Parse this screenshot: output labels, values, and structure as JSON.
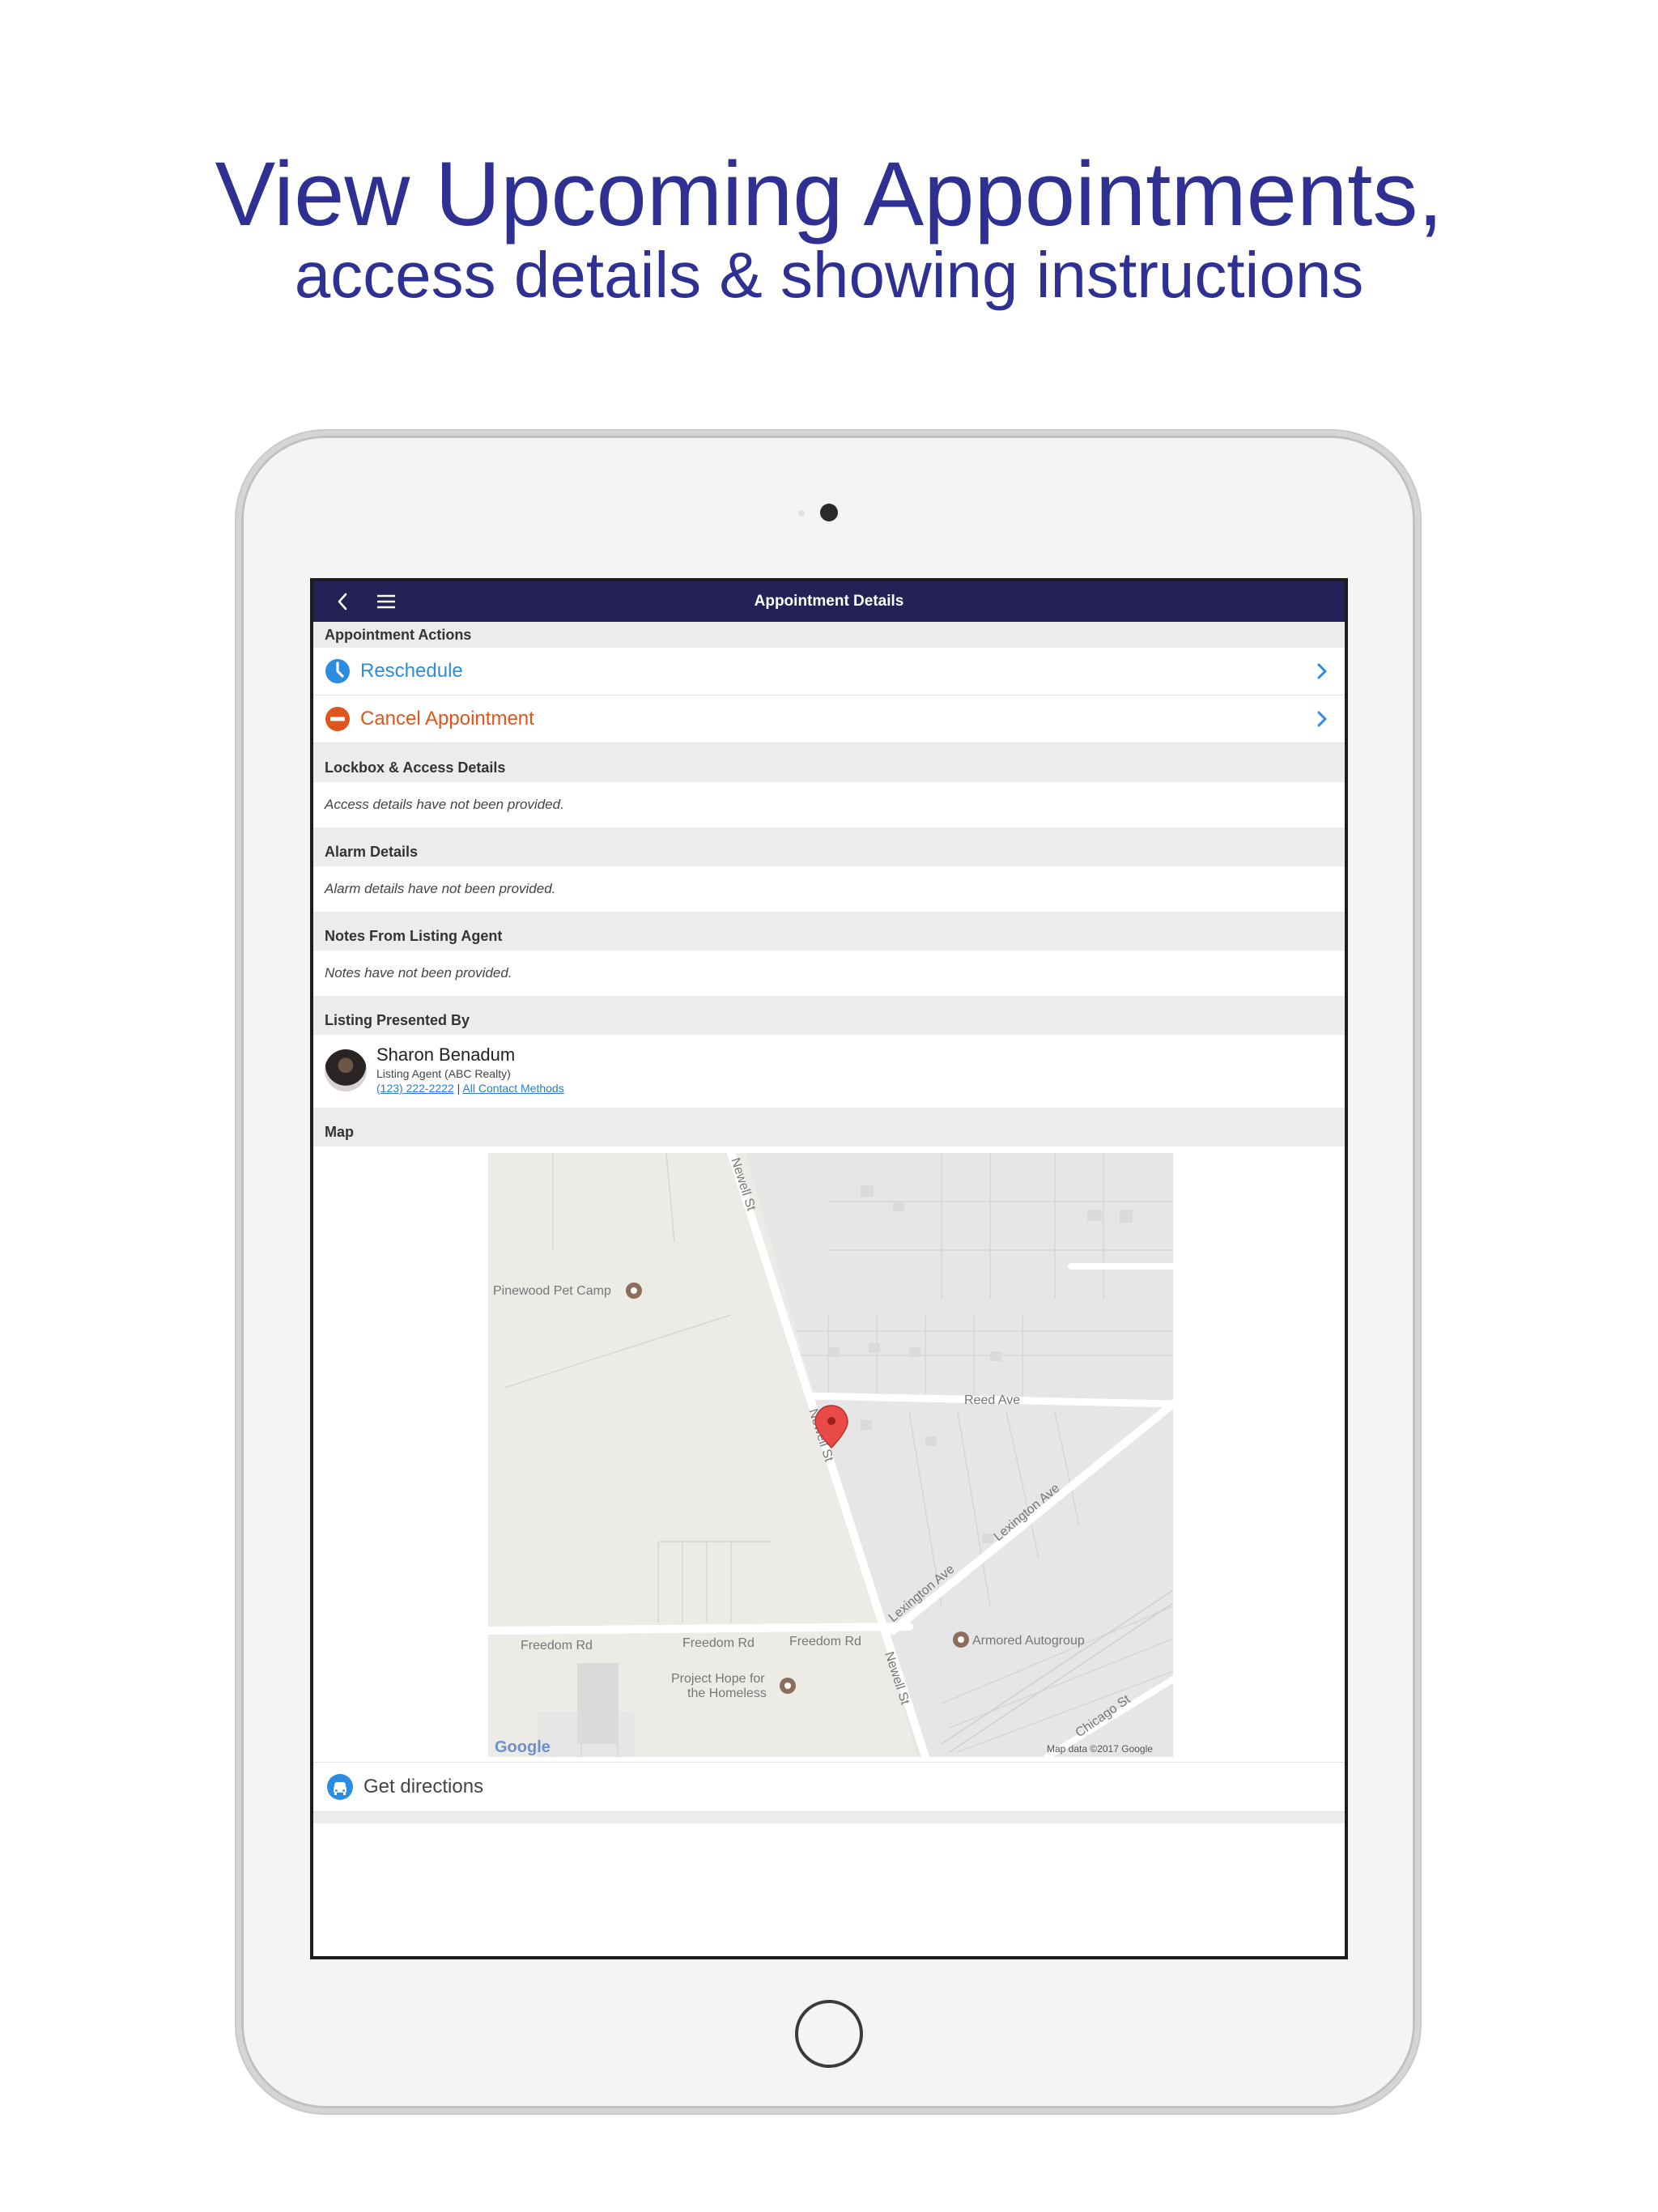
{
  "headline": {
    "line1": "View Upcoming Appointments,",
    "line2": "access details & showing instructions"
  },
  "app": {
    "title": "Appointment Details"
  },
  "actions": {
    "header": "Appointment Actions",
    "items": [
      {
        "label": "Reschedule",
        "icon": "clock-icon",
        "color": "#2b8ce0"
      },
      {
        "label": "Cancel Appointment",
        "icon": "no-entry-icon",
        "color": "#e0541e"
      }
    ]
  },
  "lockbox": {
    "header": "Lockbox & Access Details",
    "text": "Access details have not been provided."
  },
  "alarm": {
    "header": "Alarm Details",
    "text": "Alarm details have not been provided."
  },
  "notes": {
    "header": "Notes From Listing Agent",
    "text": "Notes have not been provided."
  },
  "listing": {
    "header": "Listing Presented By",
    "agent_name": "Sharon Benadum",
    "agent_role": "Listing Agent (ABC Realty)",
    "phone": "(123) 222-2222",
    "separator": "|",
    "contact_link": "All Contact Methods"
  },
  "map": {
    "header": "Map",
    "labels": {
      "pet_camp": "Pinewood Pet Camp",
      "reed_ave": "Reed Ave",
      "newell_st_top": "Newell St",
      "newell_st_mid": "Newell St",
      "newell_st_bottom": "Newell St",
      "lexington_1": "Lexington Ave",
      "lexington_2": "Lexington Ave",
      "freedom_1": "Freedom Rd",
      "freedom_2": "Freedom Rd",
      "freedom_3": "Freedom Rd",
      "armored": "Armored Autogroup",
      "project_hope_1": "Project Hope for",
      "project_hope_2": "the Homeless",
      "chicago": "Chicago St",
      "google": "Google",
      "attribution": "Map data ©2017 Google"
    }
  },
  "directions": {
    "label": "Get directions",
    "icon": "car-icon"
  },
  "colors": {
    "brand_text": "#2e3192",
    "top_bar": "#232155",
    "link_blue": "#2b8ce0",
    "cancel_orange": "#e0541e"
  }
}
